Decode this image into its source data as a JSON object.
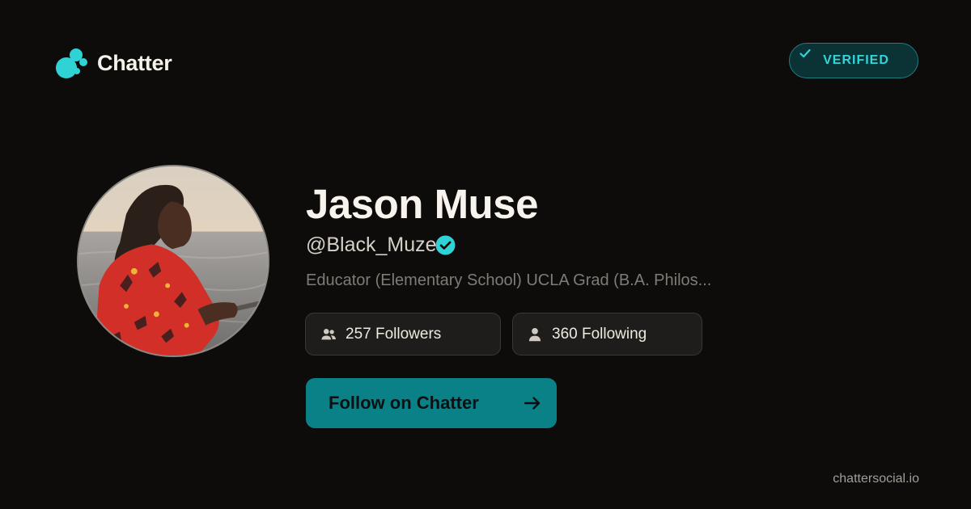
{
  "brand": {
    "name": "Chatter",
    "logo_icon": "chatter-bubbles-logo",
    "accent_color": "#2fd3d6"
  },
  "badge": {
    "label": "VERIFIED",
    "icon": "check-icon"
  },
  "profile": {
    "avatar_icon": "profile-photo",
    "display_name": "Jason Muse",
    "handle": "@Black_Muze",
    "verified_icon": "verified-badge-icon",
    "bio": "Educator (Elementary School) UCLA Grad (B.A. Philos..."
  },
  "stats": {
    "followers": {
      "icon": "users-icon",
      "label": "257 Followers"
    },
    "following": {
      "icon": "user-icon",
      "label": "360 Following"
    }
  },
  "cta": {
    "label": "Follow on Chatter",
    "icon": "arrow-right-icon",
    "color": "#0a8186"
  },
  "footer": {
    "site": "chattersocial.io"
  }
}
